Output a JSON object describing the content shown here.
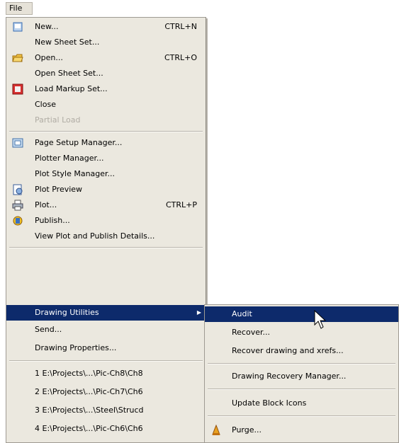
{
  "menubar": {
    "file_label": "File"
  },
  "file_menu": {
    "new": {
      "label": "New...",
      "shortcut": "CTRL+N",
      "icon": "new-document-icon"
    },
    "new_sheet_set": {
      "label": "New Sheet Set..."
    },
    "open": {
      "label": "Open...",
      "shortcut": "CTRL+O",
      "icon": "open-folder-icon"
    },
    "open_sheet_set": {
      "label": "Open Sheet Set..."
    },
    "load_markup_set": {
      "label": "Load Markup Set...",
      "icon": "markup-icon"
    },
    "close": {
      "label": "Close"
    },
    "partial_load": {
      "label": "Partial Load",
      "disabled": true
    },
    "page_setup_manager": {
      "label": "Page Setup Manager...",
      "icon": "page-setup-icon"
    },
    "plotter_manager": {
      "label": "Plotter Manager..."
    },
    "plot_style_manager": {
      "label": "Plot Style Manager..."
    },
    "plot_preview": {
      "label": "Plot Preview",
      "icon": "plot-preview-icon"
    },
    "plot": {
      "label": "Plot...",
      "shortcut": "CTRL+P",
      "icon": "printer-icon"
    },
    "publish": {
      "label": "Publish...",
      "icon": "publish-icon"
    },
    "view_plot_details": {
      "label": "View Plot and Publish Details..."
    },
    "drawing_utilities": {
      "label": "Drawing Utilities"
    },
    "send": {
      "label": "Send..."
    },
    "drawing_properties": {
      "label": "Drawing Properties..."
    },
    "recent": [
      "1 E:\\Projects\\...\\Pic-Ch8\\Ch8",
      "2 E:\\Projects\\...\\Pic-Ch7\\Ch6",
      "3 E:\\Projects\\...\\Steel\\Strucd",
      "4 E:\\Projects\\...\\Pic-Ch6\\Ch6"
    ]
  },
  "submenu": {
    "audit": {
      "label": "Audit"
    },
    "recover": {
      "label": "Recover..."
    },
    "recover_xrefs": {
      "label": "Recover drawing and xrefs..."
    },
    "recovery_manager": {
      "label": "Drawing Recovery Manager..."
    },
    "update_block_icons": {
      "label": "Update Block Icons"
    },
    "purge": {
      "label": "Purge...",
      "icon": "purge-icon"
    }
  },
  "colors": {
    "highlight": "#0d2a6b",
    "menu_bg": "#ebe8df"
  }
}
